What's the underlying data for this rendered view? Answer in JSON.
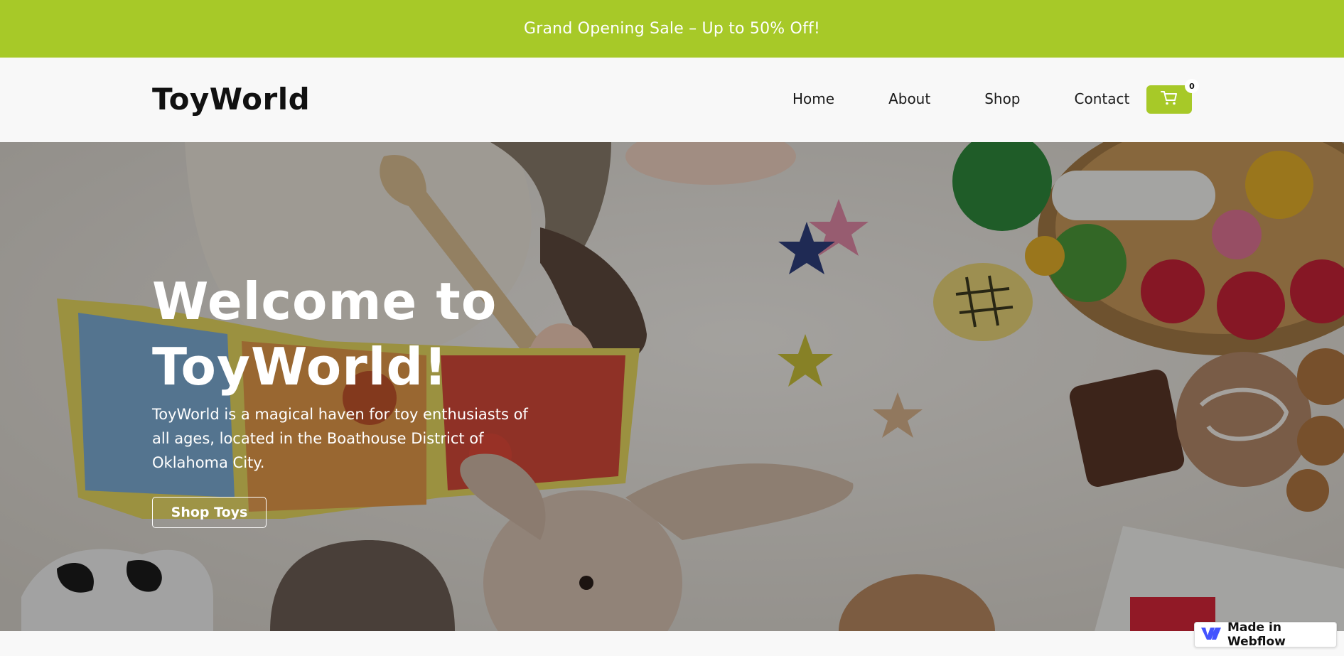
{
  "announcement": {
    "text": "Grand Opening Sale – Up to 50% Off!"
  },
  "nav": {
    "brand": "ToyWorld",
    "links": [
      {
        "label": "Home"
      },
      {
        "label": "About"
      },
      {
        "label": "Shop"
      },
      {
        "label": "Contact"
      }
    ],
    "cart_count": "0",
    "cart_icon": "cart-icon"
  },
  "hero": {
    "title_line1": "Welcome to",
    "title_line2": "ToyWorld!",
    "subtitle": "ToyWorld is a magical haven for toy enthusiasts of all ages, located in the Boathouse District of Oklahoma City.",
    "button_label": "Shop Toys"
  },
  "badge": {
    "label": "Made in Webflow",
    "icon": "webflow-logo-icon"
  },
  "colors": {
    "accent": "#a7c928",
    "text_dark": "#111111",
    "page_bg": "#f8f8f8"
  }
}
